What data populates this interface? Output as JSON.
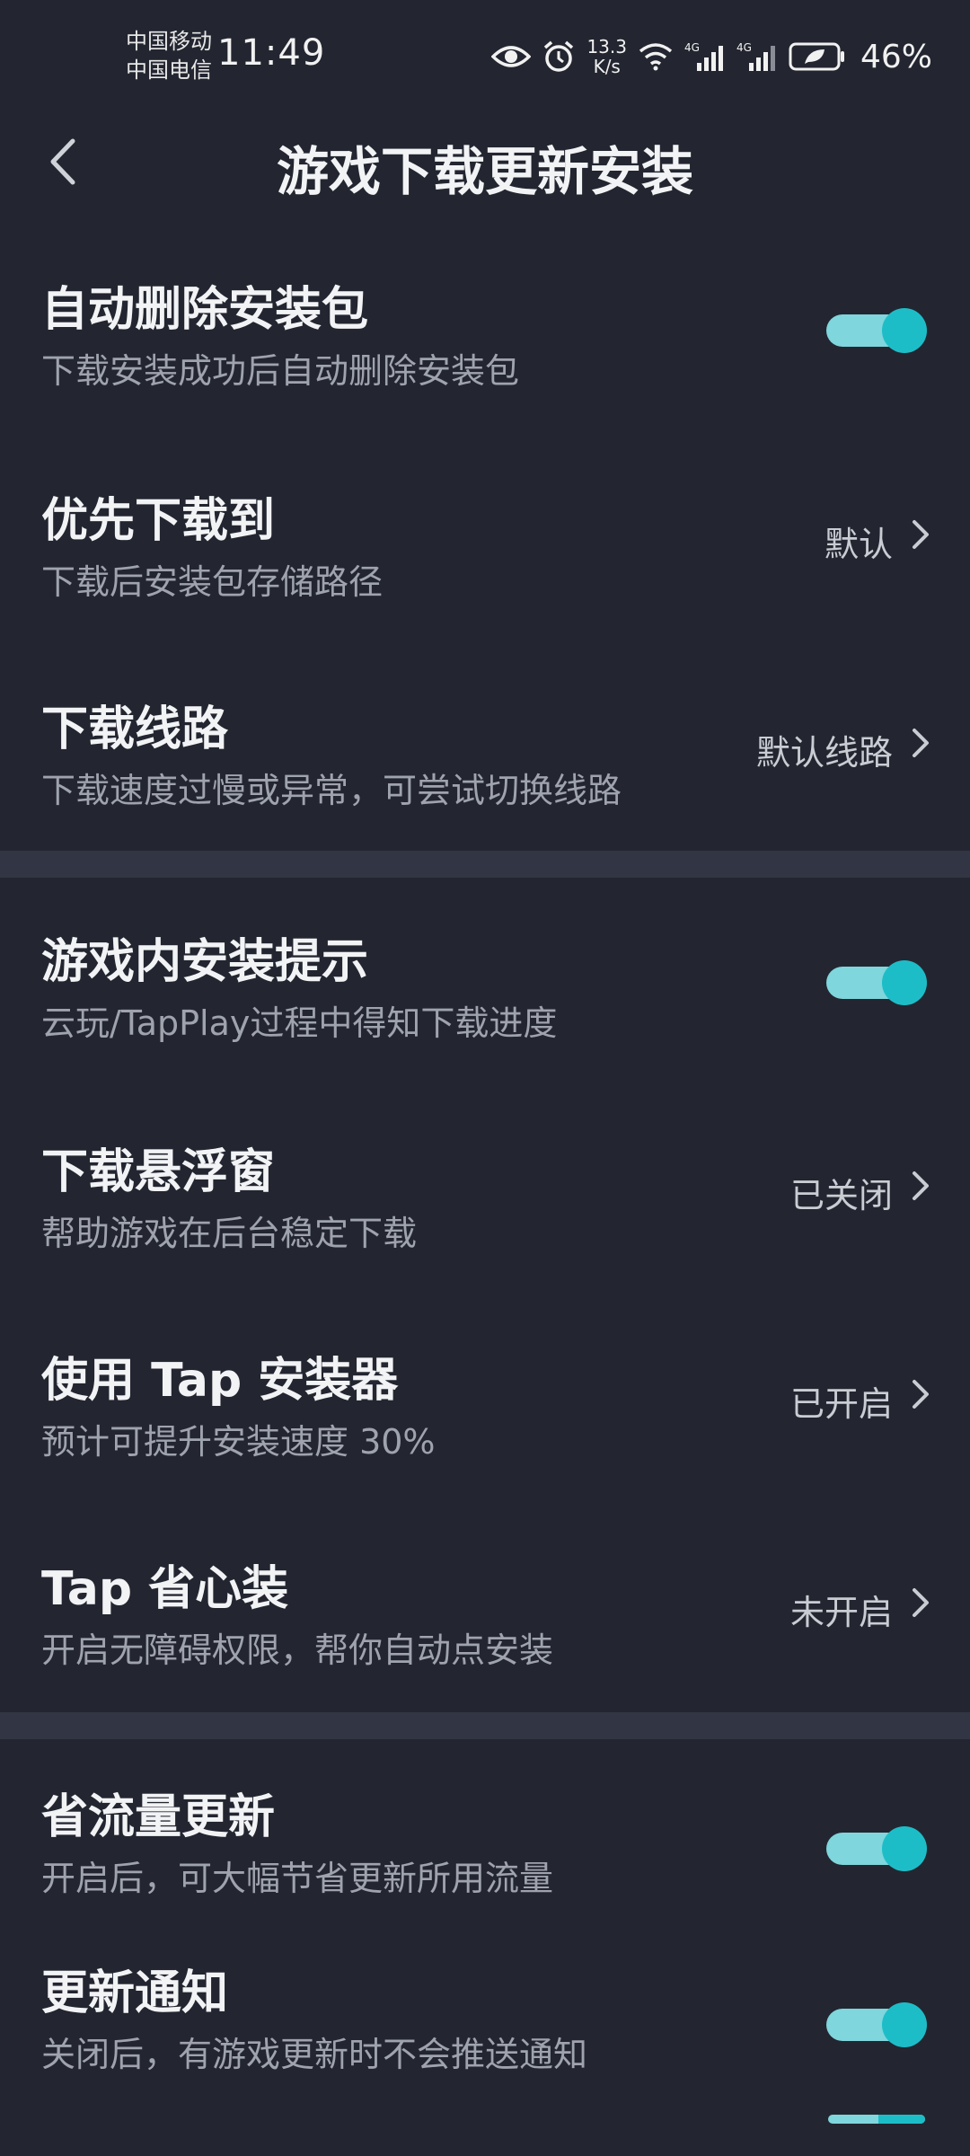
{
  "status_bar": {
    "carrier_1": "中国移动",
    "carrier_2": "中国电信",
    "time": "11:49",
    "net_speed_value": "13.3",
    "net_speed_unit": "K/s",
    "sig_1": "4G",
    "sig_2": "4G",
    "battery": "46%",
    "icons": [
      "eye-icon",
      "alarm-icon",
      "wifi-icon",
      "signal-icon",
      "signal-icon",
      "battery-icon"
    ]
  },
  "header": {
    "title": "游戏下载更新安装",
    "back_icon": "chevron-left-icon"
  },
  "settings": {
    "auto_delete": {
      "title": "自动删除安装包",
      "subtitle": "下载安装成功后自动删除安装包",
      "on": true
    },
    "download_to": {
      "title": "优先下载到",
      "subtitle": "下载后安装包存储路径",
      "value": "默认"
    },
    "download_route": {
      "title": "下载线路",
      "subtitle": "下载速度过慢或异常，可尝试切换线路",
      "value": "默认线路"
    },
    "in_game_hint": {
      "title": "游戏内安装提示",
      "subtitle": "云玩/TapPlay过程中得知下载进度",
      "on": true
    },
    "floating_window": {
      "title": "下载悬浮窗",
      "subtitle": "帮助游戏在后台稳定下载",
      "value": "已关闭"
    },
    "tap_installer": {
      "title": "使用 Tap 安装器",
      "subtitle": "预计可提升安装速度 30%",
      "value": "已开启"
    },
    "tap_easy_install": {
      "title": "Tap 省心装",
      "subtitle": "开启无障碍权限，帮你自动点安装",
      "value": "未开启"
    },
    "save_data_update": {
      "title": "省流量更新",
      "subtitle": "开启后，可大幅节省更新所用流量",
      "on": true
    },
    "update_notify": {
      "title": "更新通知",
      "subtitle": "关闭后，有游戏更新时不会推送通知",
      "on": true
    }
  },
  "colors": {
    "background": "#232630",
    "divider": "#323644",
    "toggle_track": "#7fd6dc",
    "toggle_knob": "#1dbdc8"
  }
}
